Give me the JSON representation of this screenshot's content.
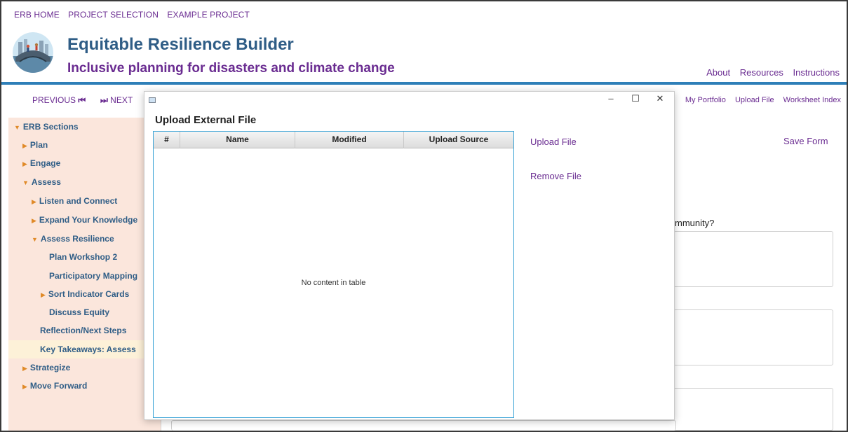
{
  "breadcrumb": [
    "ERB HOME",
    "PROJECT SELECTION",
    "EXAMPLE PROJECT"
  ],
  "header": {
    "title": "Equitable Resilience Builder",
    "subtitle": "Inclusive planning for disasters and climate change",
    "links": [
      "About",
      "Resources",
      "Instructions"
    ]
  },
  "nav": {
    "previous": "PREVIOUS",
    "next": "NEXT",
    "right_links": [
      "My Portfolio",
      "Upload File",
      "Worksheet Index"
    ]
  },
  "sidebar": {
    "items": [
      {
        "label": "ERB Sections",
        "arrow": "down"
      },
      {
        "label": "Plan",
        "arrow": "right"
      },
      {
        "label": "Engage",
        "arrow": "right"
      },
      {
        "label": "Assess",
        "arrow": "down"
      },
      {
        "label": "Listen and Connect",
        "arrow": "right"
      },
      {
        "label": "Expand Your Knowledge",
        "arrow": "right"
      },
      {
        "label": "Assess Resilience",
        "arrow": "down"
      },
      {
        "label": "Plan Workshop 2",
        "arrow": ""
      },
      {
        "label": "Participatory Mapping",
        "arrow": ""
      },
      {
        "label": "Sort Indicator Cards",
        "arrow": "right"
      },
      {
        "label": "Discuss Equity",
        "arrow": ""
      },
      {
        "label": "Reflection/Next Steps",
        "arrow": ""
      },
      {
        "label": "Key Takeaways: Assess",
        "arrow": ""
      },
      {
        "label": "Strategize",
        "arrow": "right"
      },
      {
        "label": "Move Forward",
        "arrow": "right"
      }
    ]
  },
  "main": {
    "save_form": "Save Form",
    "question_fragment": "mmunity?"
  },
  "dialog": {
    "window_controls": [
      "–",
      "☐",
      "✕"
    ],
    "heading": "Upload External File",
    "table": {
      "columns": [
        "#",
        "Name",
        "Modified",
        "Upload Source"
      ],
      "rows": [],
      "empty_message": "No content in table"
    },
    "actions": [
      "Upload File",
      "Remove File"
    ]
  },
  "colors": {
    "brand_purple": "#6a2c91",
    "brand_blue": "#2f5d86",
    "accent_rule": "#2e7fb8",
    "sidebar_bg": "#fbe6dc",
    "tree_arrow": "#e08a28",
    "table_border": "#3aa3d6"
  },
  "icons": {
    "logo": "bridge-city-logo",
    "previous": "skip-back-icon",
    "next": "skip-forward-icon",
    "dialog_app": "window-app-icon"
  }
}
